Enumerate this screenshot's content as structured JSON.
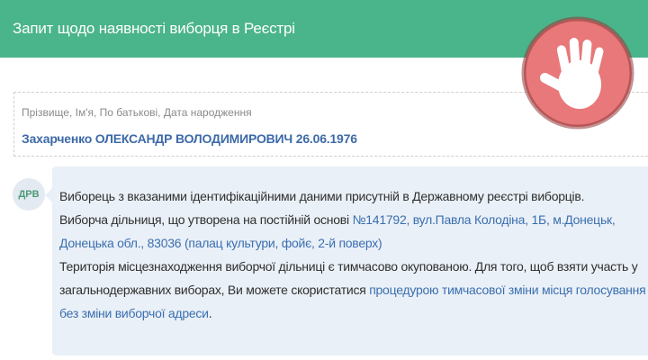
{
  "header": {
    "title": "Запит щодо наявності виборця в Реєстрі"
  },
  "query": {
    "label": "Прізвище, Ім'я, По батькові, Дата народження",
    "value": "Захарченко ОЛЕКСАНДР ВОЛОДИМИРОВИЧ 26.06.1976"
  },
  "reply": {
    "sender": "ДРВ",
    "line1": "Виборець з вказаними ідентифікаційними даними присутній в Державному реєстрі виборців.",
    "line2_text": "Виборча дільниця, що утворена на постійній основі ",
    "station_link_part1": "№141792, вул.Павла Колодіна, 1Б, м.Донецьк,",
    "station_link_part2": "Донецька обл., 83036 (палац культури, фойє, 2-й поверх)",
    "line4": "Територія місцезнаходження виборчої дільниці є тимчасово окупованою. Для того, щоб взяти участь у",
    "line5_text": "загальнодержавних виборах, Ви можете скористатися ",
    "procedure_link_part1": "процедурою тимчасової зміни місця голосування",
    "procedure_link_part2": "без зміни виборчої адреси",
    "line6_end": "."
  },
  "stamp": {
    "icon": "stop-hand-icon",
    "circle_color": "#e8787a",
    "hand_color": "#ffffff"
  },
  "colors": {
    "header_bg": "#4ab48a",
    "bubble_bg": "#eaf0f7",
    "link": "#3a6fb0"
  }
}
